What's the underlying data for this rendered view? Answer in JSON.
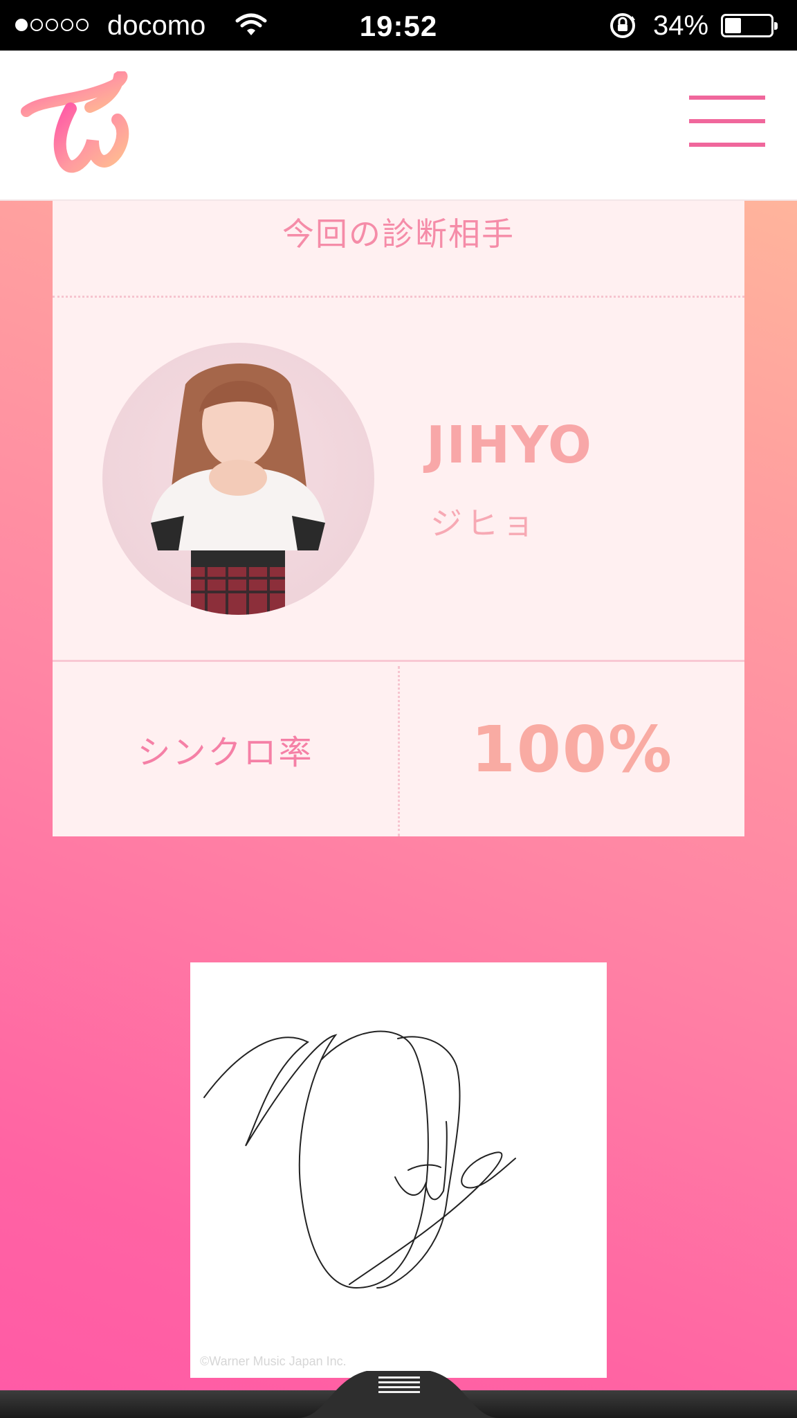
{
  "status_bar": {
    "carrier": "docomo",
    "time": "19:52",
    "battery": "34%",
    "battery_level": 0.34
  },
  "header": {
    "logo_icon": "twice-logo-icon",
    "menu_icon": "hamburger-menu-icon"
  },
  "result": {
    "title": "今回の診断相手",
    "name_en": "JIHYO",
    "name_ja": "ジヒョ",
    "sync_label": "シンクロ率",
    "sync_value": "100%"
  },
  "signature": {
    "copyright": "©Warner Music Japan Inc."
  },
  "colors": {
    "accent": "#f0679c",
    "card_bg": "#fff0f1",
    "gradient_top": "#ffc29a",
    "gradient_bottom": "#ff5aa6"
  }
}
